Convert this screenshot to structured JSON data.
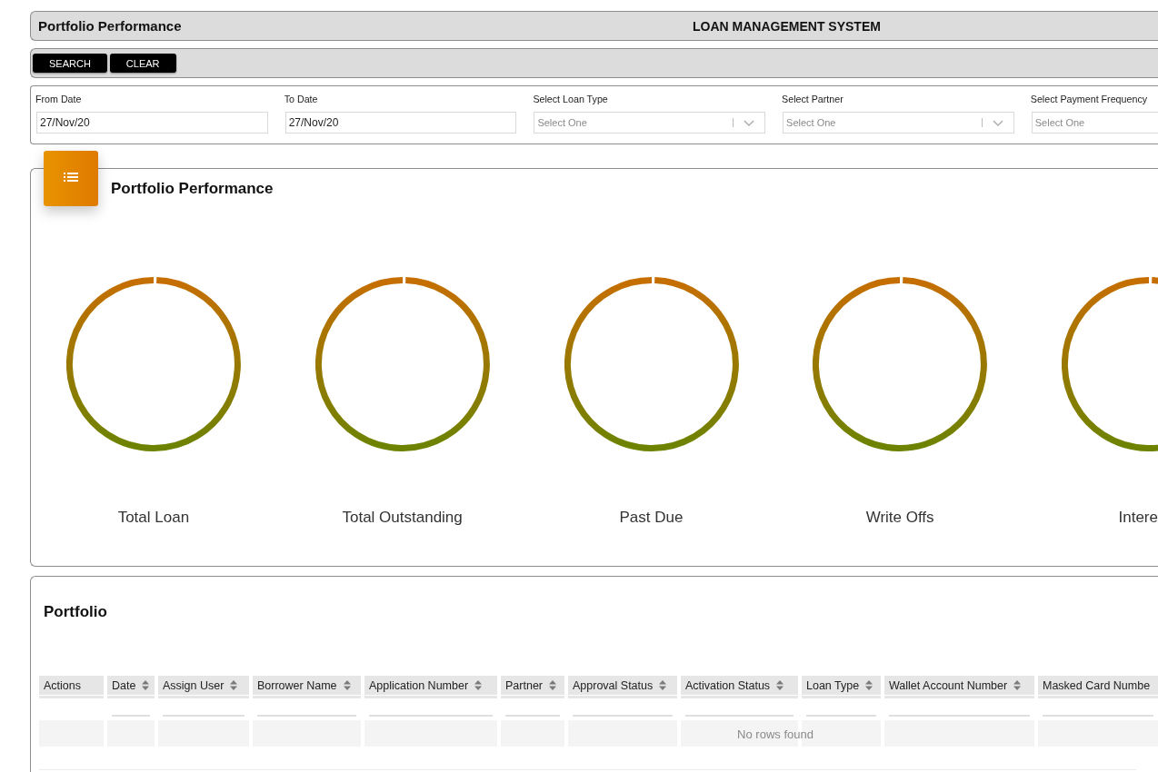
{
  "header": {
    "title": "Portfolio Performance",
    "system_name": "LOAN MANAGEMENT SYSTEM"
  },
  "toolbar": {
    "buttons": [
      "SEARCH",
      "CLEAR"
    ]
  },
  "filters": [
    {
      "label": "From Date",
      "kind": "date",
      "value": "27/Nov/20"
    },
    {
      "label": "To Date",
      "kind": "date",
      "value": "27/Nov/20"
    },
    {
      "label": "Select Loan Type",
      "kind": "select",
      "placeholder": "Select One"
    },
    {
      "label": "Select Partner",
      "kind": "select",
      "placeholder": "Select One"
    },
    {
      "label": "Select Payment Frequency",
      "kind": "select",
      "placeholder": "Select One"
    }
  ],
  "performance": {
    "title": "Portfolio Performance",
    "metrics": [
      {
        "label": "Total Loan"
      },
      {
        "label": "Total Outstanding"
      },
      {
        "label": "Past Due"
      },
      {
        "label": "Write Offs"
      },
      {
        "label": "Intere"
      }
    ]
  },
  "portfolio": {
    "title": "Portfolio",
    "table": {
      "columns": [
        {
          "label": "Actions",
          "sortable": false,
          "filter": false
        },
        {
          "label": "Date",
          "sortable": true,
          "filter": true
        },
        {
          "label": "Assign User",
          "sortable": true,
          "filter": true
        },
        {
          "label": "Borrower Name",
          "sortable": true,
          "filter": true
        },
        {
          "label": "Application Number",
          "sortable": true,
          "filter": true
        },
        {
          "label": "Partner",
          "sortable": true,
          "filter": true
        },
        {
          "label": "Approval Status",
          "sortable": true,
          "filter": true
        },
        {
          "label": "Activation Status",
          "sortable": true,
          "filter": true
        },
        {
          "label": "Loan Type",
          "sortable": true,
          "filter": true
        },
        {
          "label": "Wallet Account Number",
          "sortable": true,
          "filter": true
        },
        {
          "label": "Masked Card Numbe",
          "sortable": false,
          "filter": true
        }
      ],
      "empty_message": "No rows found"
    }
  }
}
